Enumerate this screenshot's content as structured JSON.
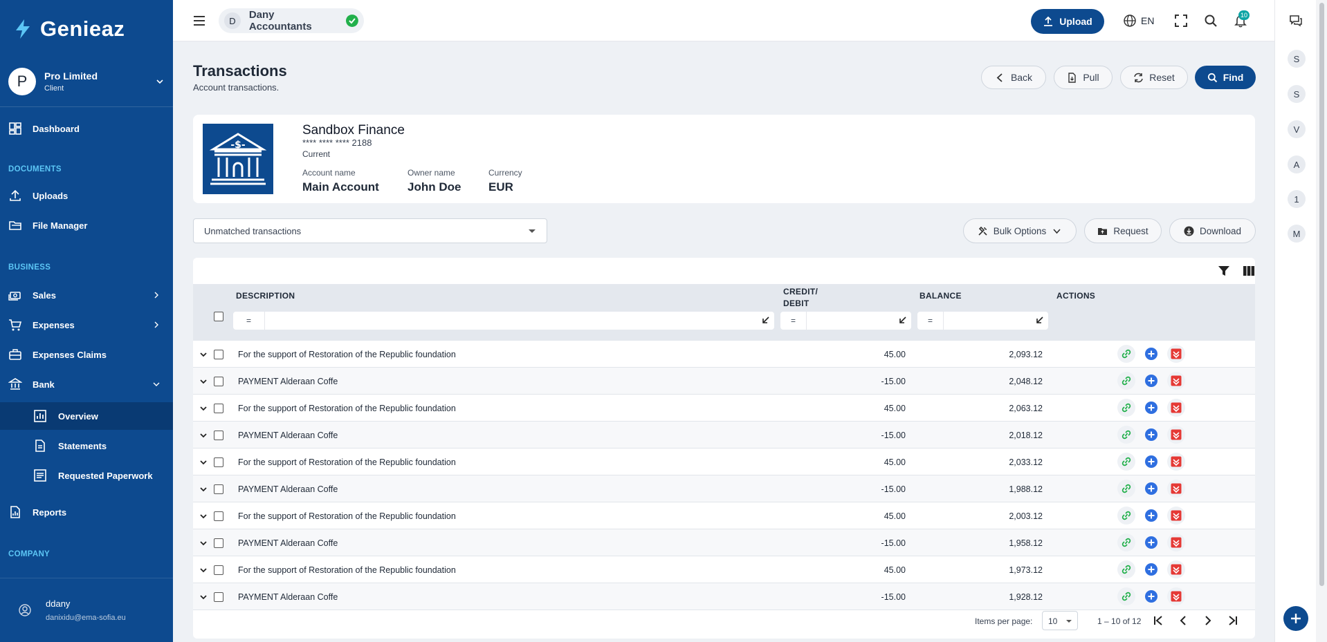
{
  "brand": {
    "name": "Genieaz",
    "accent": "#0d4a8f",
    "highlight": "#5cc6f5"
  },
  "org": {
    "avatar": "P",
    "name": "Pro Limited",
    "role": "Client"
  },
  "sidebar": {
    "dashboard": "Dashboard",
    "sections": {
      "documents": "DOCUMENTS",
      "business": "BUSINESS",
      "company": "COMPANY"
    },
    "uploads": "Uploads",
    "file_manager": "File Manager",
    "sales": "Sales",
    "expenses": "Expenses",
    "expenses_claims": "Expenses Claims",
    "bank": "Bank",
    "overview": "Overview",
    "statements": "Statements",
    "requested_paperwork": "Requested Paperwork",
    "reports": "Reports"
  },
  "user": {
    "name": "ddany",
    "email": "danixidu@ema-sofia.eu"
  },
  "topbar": {
    "tenant_avatar": "D",
    "tenant_name": "Dany Accountants",
    "upload": "Upload",
    "language": "EN",
    "notifications": "10"
  },
  "rail": {
    "avatars": [
      "S",
      "S",
      "V",
      "A",
      "1",
      "M"
    ]
  },
  "page": {
    "title": "Transactions",
    "subtitle": "Account transactions.",
    "back": "Back",
    "pull": "Pull",
    "reset": "Reset",
    "find": "Find"
  },
  "account": {
    "bank": "Sandbox Finance",
    "number": "**** **** **** 2188",
    "type": "Current",
    "fields": [
      {
        "label": "Account name",
        "value": "Main Account"
      },
      {
        "label": "Owner name",
        "value": "John Doe"
      },
      {
        "label": "Currency",
        "value": "EUR"
      }
    ]
  },
  "filter": {
    "selected": "Unmatched transactions",
    "bulk_options": "Bulk Options",
    "request": "Request",
    "download": "Download"
  },
  "table": {
    "columns": {
      "description": "DESCRIPTION",
      "credit_debit": "CREDIT/ DEBIT",
      "balance": "BALANCE",
      "actions": "ACTIONS"
    },
    "filter_op": "=",
    "rows": [
      {
        "description": "For the support of Restoration of the Republic foundation",
        "amount": "45.00",
        "balance": "2,093.12"
      },
      {
        "description": "PAYMENT Alderaan Coffe",
        "amount": "-15.00",
        "balance": "2,048.12"
      },
      {
        "description": "For the support of Restoration of the Republic foundation",
        "amount": "45.00",
        "balance": "2,063.12"
      },
      {
        "description": "PAYMENT Alderaan Coffe",
        "amount": "-15.00",
        "balance": "2,018.12"
      },
      {
        "description": "For the support of Restoration of the Republic foundation",
        "amount": "45.00",
        "balance": "2,033.12"
      },
      {
        "description": "PAYMENT Alderaan Coffe",
        "amount": "-15.00",
        "balance": "1,988.12"
      },
      {
        "description": "For the support of Restoration of the Republic foundation",
        "amount": "45.00",
        "balance": "2,003.12"
      },
      {
        "description": "PAYMENT Alderaan Coffe",
        "amount": "-15.00",
        "balance": "1,958.12"
      },
      {
        "description": "For the support of Restoration of the Republic foundation",
        "amount": "45.00",
        "balance": "1,973.12"
      },
      {
        "description": "PAYMENT Alderaan Coffe",
        "amount": "-15.00",
        "balance": "1,928.12"
      }
    ]
  },
  "pagination": {
    "items_per_page_label": "Items per page:",
    "items_per_page": "10",
    "range": "1 – 10 of 12"
  }
}
